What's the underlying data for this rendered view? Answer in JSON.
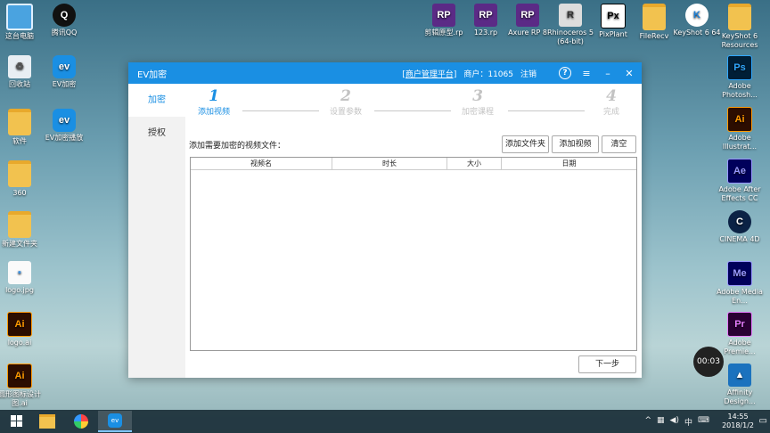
{
  "desktop": {
    "left_icons": [
      {
        "label": "这台电脑",
        "icon": "pc-icon"
      },
      {
        "label": "腾讯QQ",
        "icon": "qq-icon"
      },
      {
        "label": "回收站",
        "icon": "recycle-bin-icon"
      },
      {
        "label": "EV加密",
        "icon": "ev-icon"
      },
      {
        "label": "软件",
        "icon": "folder-icon"
      },
      {
        "label": "EV加密播放",
        "icon": "ev-icon"
      },
      {
        "label": "360",
        "icon": "folder-icon"
      },
      {
        "label": "新建文件夹",
        "icon": "folder-icon"
      },
      {
        "label": "logo.jpg",
        "icon": "file-icon"
      },
      {
        "label": "logo.ai",
        "icon": "ai-icon"
      },
      {
        "label": "圆形图标设计图.ai",
        "icon": "ai-icon"
      }
    ],
    "top_icons": [
      {
        "label": "剪辑原型.rp",
        "icon": "rp-icon"
      },
      {
        "label": "123.rp",
        "icon": "rp-icon"
      },
      {
        "label": "Axure RP 8",
        "icon": "rp-icon"
      },
      {
        "label": "Rhinoceros 5 (64-bit)",
        "icon": "rhino-icon"
      },
      {
        "label": "PixPlant",
        "icon": "pixplant-icon"
      },
      {
        "label": "FileRecv",
        "icon": "folder-icon"
      },
      {
        "label": "KeyShot 6 64",
        "icon": "keyshot-icon"
      },
      {
        "label": "KeyShot 6 Resources",
        "icon": "folder-icon"
      }
    ],
    "right_icons": [
      {
        "label": "Adobe Photosh...",
        "icon": "photoshop-icon"
      },
      {
        "label": "Adobe Illustrat...",
        "icon": "illustrator-icon"
      },
      {
        "label": "Adobe After Effects CC",
        "icon": "after-effects-icon"
      },
      {
        "label": "CINEMA 4D",
        "icon": "cinema4d-icon"
      },
      {
        "label": "Adobe Media En...",
        "icon": "media-encoder-icon"
      },
      {
        "label": "Adobe Premie...",
        "icon": "premiere-icon"
      },
      {
        "label": "Affinity Design...",
        "icon": "affinity-icon"
      }
    ],
    "recorder_time": "00:03"
  },
  "window": {
    "title": "EV加密",
    "merchant_platform": "[商户管理平台]",
    "merchant_label": "商户：11065",
    "logout": "注销",
    "help": "?",
    "minimize": "–",
    "close": "✕",
    "sidebar": [
      {
        "label": "加密",
        "active": true
      },
      {
        "label": "授权",
        "active": false
      }
    ],
    "steps": [
      {
        "num": "1",
        "label": "添加视频",
        "active": true
      },
      {
        "num": "2",
        "label": "设置参数",
        "active": false
      },
      {
        "num": "3",
        "label": "加密课程",
        "active": false
      },
      {
        "num": "4",
        "label": "完成",
        "active": false
      }
    ],
    "hint": "添加需要加密的视频文件：",
    "buttons": {
      "add_folder": "添加文件夹",
      "add_video": "添加视频",
      "clear": "清空",
      "next": "下一步"
    },
    "table_headers": [
      "视频名",
      "时长",
      "大小",
      "日期"
    ]
  },
  "taskbar": {
    "time": "14:55",
    "date": "2018/1/2",
    "ime": "中"
  }
}
